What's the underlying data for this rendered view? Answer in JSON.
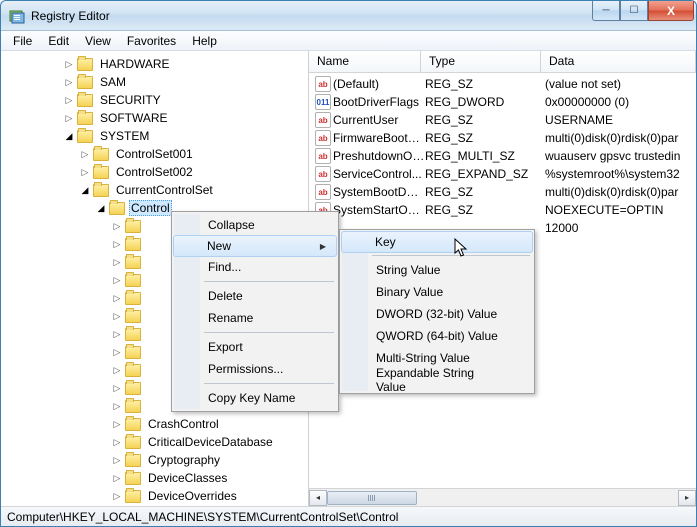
{
  "window": {
    "title": "Registry Editor"
  },
  "menubar": [
    "File",
    "Edit",
    "View",
    "Favorites",
    "Help"
  ],
  "tree": {
    "top": [
      {
        "label": "HARDWARE",
        "depth": 2,
        "twist": "▷"
      },
      {
        "label": "SAM",
        "depth": 2,
        "twist": "▷"
      },
      {
        "label": "SECURITY",
        "depth": 2,
        "twist": "▷"
      },
      {
        "label": "SOFTWARE",
        "depth": 2,
        "twist": "▷"
      },
      {
        "label": "SYSTEM",
        "depth": 2,
        "twist": "◢"
      },
      {
        "label": "ControlSet001",
        "depth": 3,
        "twist": "▷"
      },
      {
        "label": "ControlSet002",
        "depth": 3,
        "twist": "▷"
      },
      {
        "label": "CurrentControlSet",
        "depth": 3,
        "twist": "◢"
      },
      {
        "label": "Control",
        "depth": 4,
        "twist": "◢",
        "sel": true
      }
    ],
    "bottom": [
      {
        "label": "CrashControl",
        "depth": 5
      },
      {
        "label": "CriticalDeviceDatabase",
        "depth": 5
      },
      {
        "label": "Cryptography",
        "depth": 5
      },
      {
        "label": "DeviceClasses",
        "depth": 5
      },
      {
        "label": "DeviceOverrides",
        "depth": 5
      }
    ],
    "mid_indent": 5
  },
  "list": {
    "columns": {
      "name": "Name",
      "type": "Type",
      "data": "Data"
    },
    "rows": [
      {
        "ico": "str",
        "name": "(Default)",
        "type": "REG_SZ",
        "data": "(value not set)"
      },
      {
        "ico": "bin",
        "name": "BootDriverFlags",
        "type": "REG_DWORD",
        "data": "0x00000000 (0)"
      },
      {
        "ico": "str",
        "name": "CurrentUser",
        "type": "REG_SZ",
        "data": "USERNAME"
      },
      {
        "ico": "str",
        "name": "FirmwareBootD...",
        "type": "REG_SZ",
        "data": "multi(0)disk(0)rdisk(0)par"
      },
      {
        "ico": "str",
        "name": "PreshutdownOr...",
        "type": "REG_MULTI_SZ",
        "data": "wuauserv gpsvc trustedin"
      },
      {
        "ico": "str",
        "name": "ServiceControl...",
        "type": "REG_EXPAND_SZ",
        "data": "%systemroot%\\system32"
      },
      {
        "ico": "str",
        "name": "SystemBootDevi...",
        "type": "REG_SZ",
        "data": "multi(0)disk(0)rdisk(0)par"
      },
      {
        "ico": "str",
        "name": "SystemStartOpti...",
        "type": "REG_SZ",
        "data": " NOEXECUTE=OPTIN"
      },
      {
        "ico": "bin",
        "name": "",
        "type": "",
        "data": "12000",
        "hidden_icon": true
      }
    ]
  },
  "ctx1": {
    "items": [
      {
        "label": "Collapse"
      },
      {
        "label": "New",
        "hover": true,
        "arrow": true
      },
      {
        "label": "Find..."
      },
      {
        "sep": true
      },
      {
        "label": "Delete"
      },
      {
        "label": "Rename"
      },
      {
        "sep": true
      },
      {
        "label": "Export"
      },
      {
        "label": "Permissions..."
      },
      {
        "sep": true
      },
      {
        "label": "Copy Key Name"
      }
    ]
  },
  "ctx2": {
    "items": [
      {
        "label": "Key",
        "hover": true
      },
      {
        "sep": true
      },
      {
        "label": "String Value"
      },
      {
        "label": "Binary Value"
      },
      {
        "label": "DWORD (32-bit) Value"
      },
      {
        "label": "QWORD (64-bit) Value"
      },
      {
        "label": "Multi-String Value"
      },
      {
        "label": "Expandable String Value"
      }
    ]
  },
  "statusbar": "Computer\\HKEY_LOCAL_MACHINE\\SYSTEM\\CurrentControlSet\\Control",
  "icon_txt": {
    "str": "ab",
    "bin": "011"
  }
}
